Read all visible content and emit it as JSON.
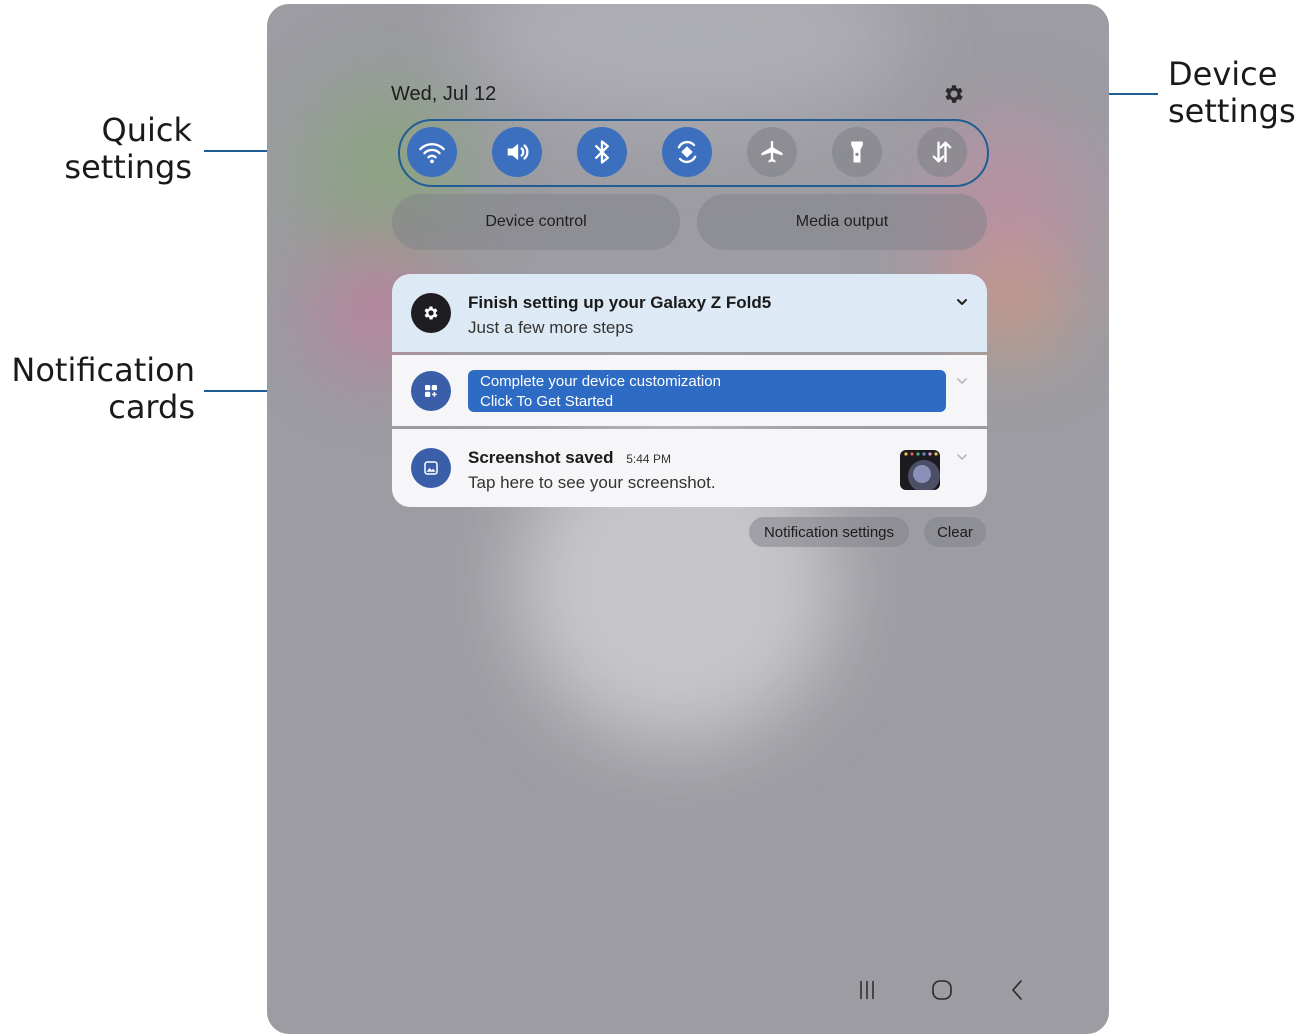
{
  "callouts": {
    "quick_settings": [
      "Quick",
      "settings"
    ],
    "device_settings": [
      "Device",
      "settings"
    ],
    "notification_cards": [
      "Notification",
      "cards"
    ]
  },
  "panel": {
    "date": "Wed, Jul 12",
    "settings_icon": "gear-icon",
    "quick_settings": [
      {
        "icon": "wifi-icon",
        "state": "on"
      },
      {
        "icon": "sound-icon",
        "state": "on"
      },
      {
        "icon": "bluetooth-icon",
        "state": "on"
      },
      {
        "icon": "auto-rotate-icon",
        "state": "on"
      },
      {
        "icon": "airplane-icon",
        "state": "off"
      },
      {
        "icon": "flashlight-icon",
        "state": "off"
      },
      {
        "icon": "mobile-data-icon",
        "state": "off"
      }
    ],
    "device_control": "Device control",
    "media_output": "Media output"
  },
  "notifications": [
    {
      "title": "Finish setting up your Galaxy Z Fold5",
      "subtitle": "Just a few more steps",
      "icon": "settings-icon"
    },
    {
      "title": "Complete your device customization",
      "subtitle": "Click To Get Started",
      "icon": "customize-icon"
    },
    {
      "title": "Screenshot saved",
      "time": "5:44 PM",
      "subtitle": "Tap here to see your screenshot.",
      "icon": "gallery-icon"
    }
  ],
  "actions": {
    "notification_settings": "Notification settings",
    "clear": "Clear"
  },
  "navbar": [
    "recents-icon",
    "home-icon",
    "back-icon"
  ],
  "colors": {
    "accent": "#3c6fbe",
    "leader": "#1f5d94",
    "cta": "#2d6bc4",
    "card_highlight": "#dde9f5"
  }
}
